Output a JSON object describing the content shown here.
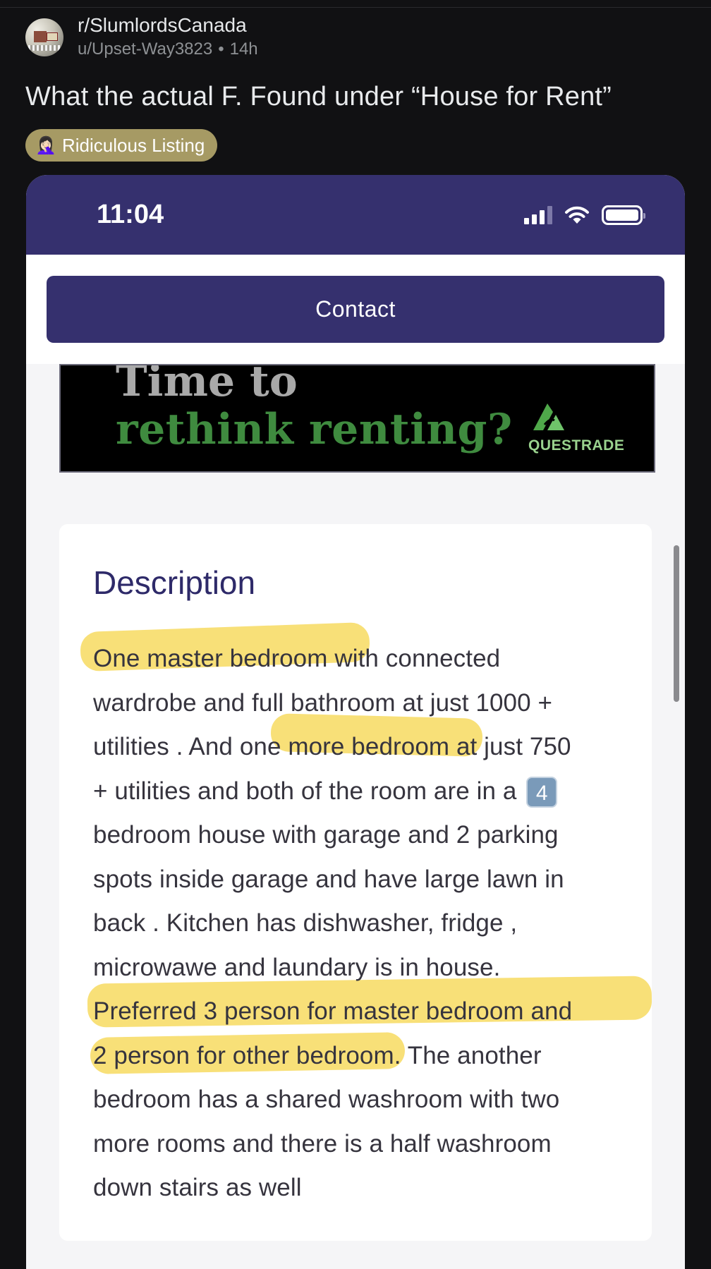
{
  "post": {
    "subreddit": "r/SlumlordsCanada",
    "author": "u/Upset-Way3823",
    "separator": "•",
    "age": "14h",
    "title": "What the actual F. Found under “House for Rent”",
    "flair": {
      "emoji": "🤦🏻‍♀️",
      "label": "Ridiculous Listing",
      "color": "#a69a64"
    }
  },
  "screenshot": {
    "status_bar": {
      "time": "11:04",
      "icons": [
        "signal-icon",
        "wifi-icon",
        "battery-icon"
      ],
      "color": "#35306e"
    },
    "contact_button": {
      "label": "Contact"
    },
    "ad": {
      "headline_line1": "Time to",
      "headline_line2": "rethink renting?",
      "brand": "QUESTRADE",
      "brand_color": "#3f8b3f"
    },
    "description": {
      "heading": "Description",
      "lines": [
        "One master bedroom with connected",
        "wardrobe and full bathroom at just 1000 +",
        "utilities . And one more bedroom at just 750",
        "+ utilities and both of the room are in a",
        "bedroom house with garage and 2 parking",
        "spots inside garage and have large lawn in",
        "back . Kitchen has dishwasher, fridge ,",
        "microwawe and laundary is in house.",
        "Preferred 3 person for master bedroom and",
        "2 person for other bedroom. The another",
        "bedroom has a shared washroom with two",
        "more rooms and there is a half washroom",
        "down stairs as well"
      ],
      "keycap_emoji": "4",
      "highlight_color": "#f6d752"
    }
  }
}
